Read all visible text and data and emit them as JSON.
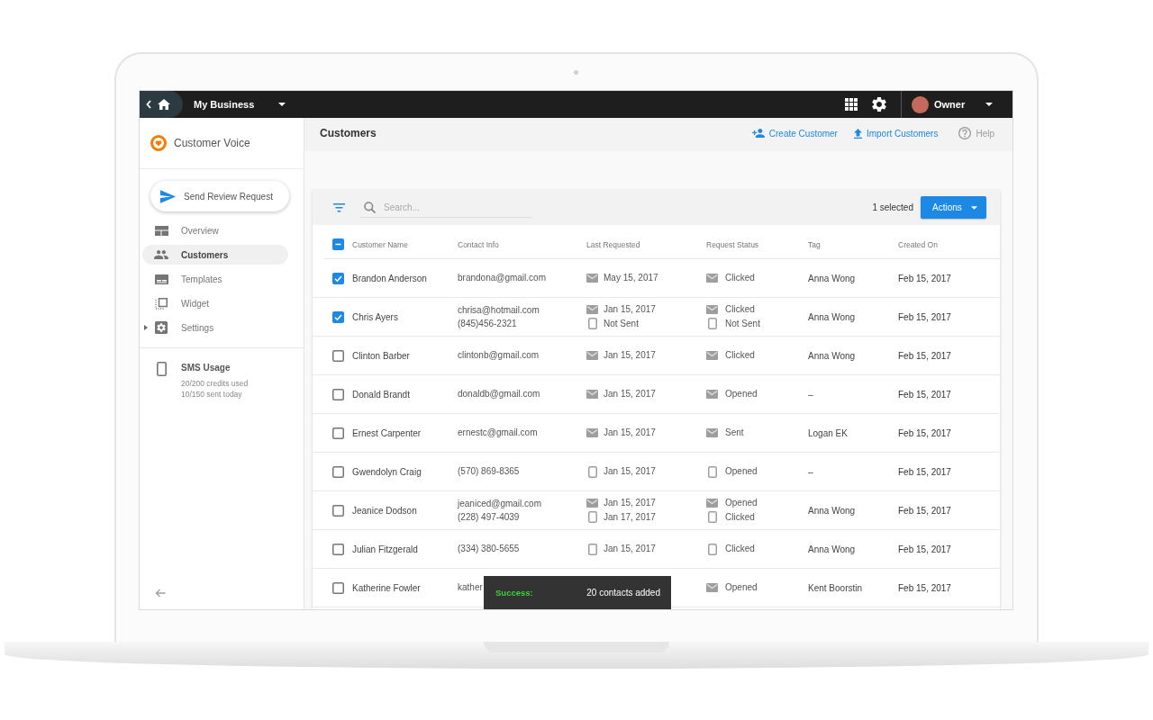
{
  "top_bar": {
    "business": "My Business",
    "user": "Owner"
  },
  "sidebar": {
    "app_name": "Customer Voice",
    "primary_button": "Send Review Request",
    "items": [
      {
        "label": "Overview",
        "selected": false
      },
      {
        "label": "Customers",
        "selected": true
      },
      {
        "label": "Templates",
        "selected": false
      },
      {
        "label": "Widget",
        "selected": false
      },
      {
        "label": "Settings",
        "selected": false,
        "expanded": false
      }
    ],
    "sms_usage": {
      "title": "SMS Usage",
      "lines": [
        "20/200 credits used",
        "10/150 sent today"
      ]
    }
  },
  "header": {
    "title": "Customers",
    "actions": [
      "Create Customer",
      "Import Customers"
    ],
    "help": "Help"
  },
  "toolbar": {
    "search": {
      "placeholder": "Search..."
    },
    "selection": "1 selected",
    "button": "Actions"
  },
  "table": {
    "select_all": {
      "indeterminate": true
    },
    "columns": [
      "Customer Name",
      "Contact Info",
      "Last Requested",
      "Request Status",
      "Tag",
      "Created On"
    ],
    "rows": [
      {
        "selected": true,
        "name": "Brandon Anderson",
        "contact": [
          "brandona@gmail.com"
        ],
        "last_requested": [
          {
            "kind": "email",
            "text": "May 15, 2017"
          }
        ],
        "status": [
          {
            "kind": "email",
            "text": "Clicked"
          }
        ],
        "tag": "Anna Wong",
        "created": "Feb 15, 2017"
      },
      {
        "selected": true,
        "name": "Chris Ayers",
        "contact": [
          "chrisa@hotmail.com",
          "(845)456-2321"
        ],
        "last_requested": [
          {
            "kind": "email",
            "text": "Jan 15, 2017"
          },
          {
            "kind": "sms",
            "text": "Not Sent"
          }
        ],
        "status": [
          {
            "kind": "email",
            "text": "Clicked"
          },
          {
            "kind": "sms",
            "text": "Not Sent"
          }
        ],
        "tag": "Anna Wong",
        "created": "Feb 15, 2017"
      },
      {
        "selected": false,
        "name": "Clinton Barber",
        "contact": [
          "clintonb@gmail.com"
        ],
        "last_requested": [
          {
            "kind": "email",
            "text": "Jan 15, 2017"
          }
        ],
        "status": [
          {
            "kind": "email",
            "text": "Clicked"
          }
        ],
        "tag": "Anna Wong",
        "created": "Feb 15, 2017"
      },
      {
        "selected": false,
        "name": "Donald Brandt",
        "contact": [
          "donaldb@gmail.com"
        ],
        "last_requested": [
          {
            "kind": "email",
            "text": "Jan 15, 2017"
          }
        ],
        "status": [
          {
            "kind": "email",
            "text": "Opened"
          }
        ],
        "tag": "–",
        "created": "Feb 15, 2017"
      },
      {
        "selected": false,
        "name": "Ernest Carpenter",
        "contact": [
          "ernestc@gmail.com"
        ],
        "last_requested": [
          {
            "kind": "email",
            "text": "Jan 15, 2017"
          }
        ],
        "status": [
          {
            "kind": "email",
            "text": "Sent"
          }
        ],
        "tag": "Logan EK",
        "created": "Feb 15, 2017"
      },
      {
        "selected": false,
        "name": "Gwendolyn Craig",
        "contact": [
          "(570) 869-8365"
        ],
        "last_requested": [
          {
            "kind": "sms",
            "text": "Jan 15, 2017"
          }
        ],
        "status": [
          {
            "kind": "sms",
            "text": "Opened"
          }
        ],
        "tag": "–",
        "created": "Feb 15, 2017"
      },
      {
        "selected": false,
        "name": "Jeanice Dodson",
        "contact": [
          "jeaniced@gmail.com",
          "(228) 497-4039"
        ],
        "last_requested": [
          {
            "kind": "email",
            "text": "Jan 15, 2017"
          },
          {
            "kind": "sms",
            "text": "Jan 17, 2017"
          }
        ],
        "status": [
          {
            "kind": "email",
            "text": "Opened"
          },
          {
            "kind": "sms",
            "text": "Clicked"
          }
        ],
        "tag": "Anna Wong",
        "created": "Feb 15, 2017"
      },
      {
        "selected": false,
        "name": "Julian Fitzgerald",
        "contact": [
          "(334) 380-5655"
        ],
        "last_requested": [
          {
            "kind": "sms",
            "text": "Jan 15, 2017"
          }
        ],
        "status": [
          {
            "kind": "sms",
            "text": "Clicked"
          }
        ],
        "tag": "Anna Wong",
        "created": "Feb 15, 2017"
      },
      {
        "selected": false,
        "name": "Katherine Fowler",
        "contact": [
          "kather"
        ],
        "status": [
          {
            "kind": "email",
            "text": "Opened"
          }
        ],
        "tag": "Kent Boorstin",
        "created": "Feb 15, 2017"
      }
    ]
  },
  "toast": {
    "title": "Success:",
    "message": "20 contacts added"
  }
}
